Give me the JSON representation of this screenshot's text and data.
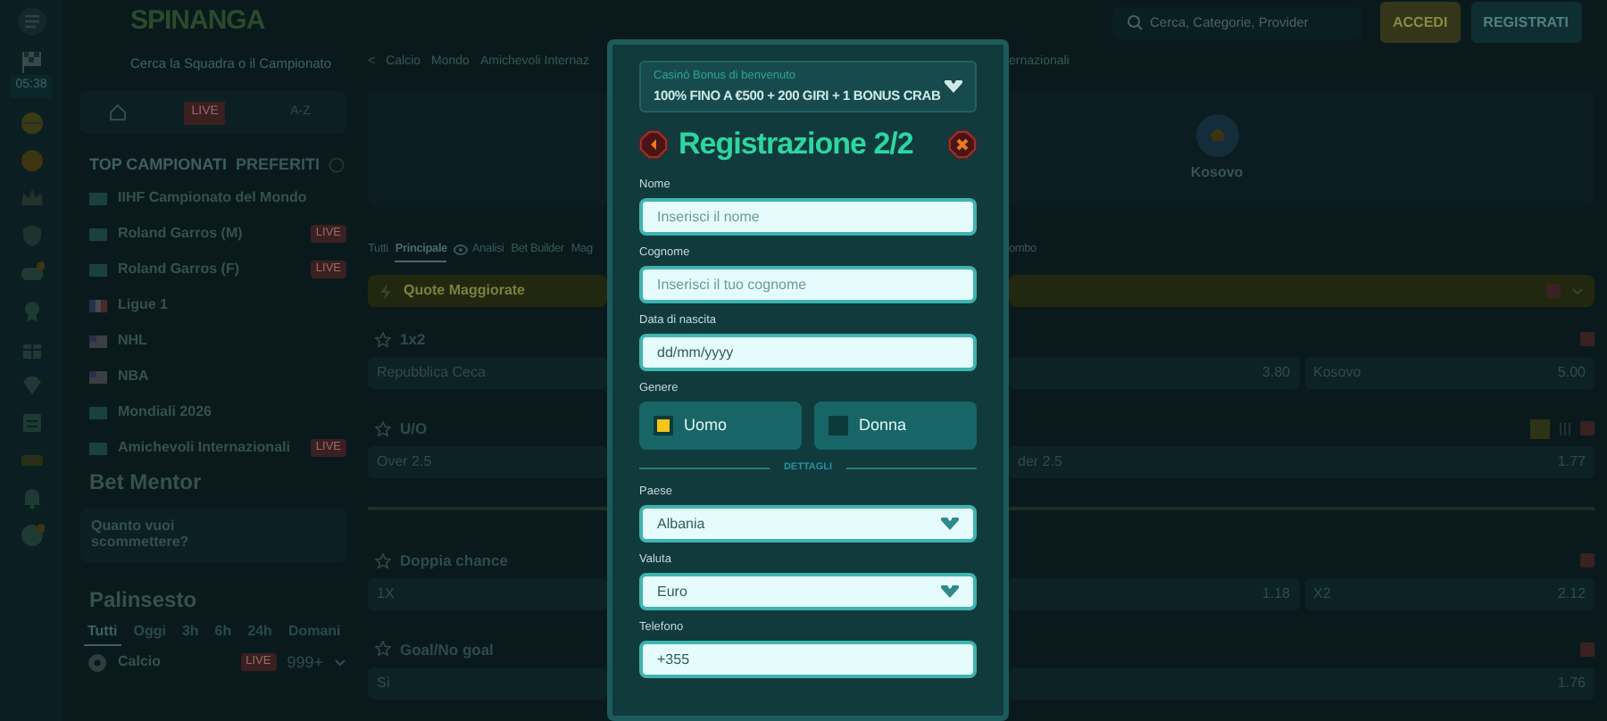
{
  "rail": {
    "clock": "05:38"
  },
  "sidebar": {
    "logo": "SPINANGA",
    "search_placeholder": "Cerca la Squadra o il Campionato",
    "tabs": [
      {
        "kind": "home"
      },
      {
        "kind": "live",
        "label": "LIVE"
      },
      {
        "kind": "text",
        "label": "A-Z"
      }
    ],
    "top_title": "TOP CAMPIONATI",
    "fav_title": "PREFERITI",
    "leagues": [
      {
        "name": "IIHF Campionato del Mondo",
        "kind": "world"
      },
      {
        "name": "Roland Garros (M)",
        "kind": "world",
        "badge": "LIVE"
      },
      {
        "name": "Roland Garros (F)",
        "kind": "world",
        "badge": "LIVE"
      },
      {
        "name": "Ligue 1",
        "kind": "france"
      },
      {
        "name": "NHL",
        "kind": "usa"
      },
      {
        "name": "NBA",
        "kind": "usa"
      },
      {
        "name": "Mondiali 2026",
        "kind": "world"
      },
      {
        "name": "Amichevoli Internazionali",
        "kind": "world",
        "badge": "LIVE"
      }
    ],
    "bet_mentor": {
      "title": "Bet Mentor",
      "prompt": "Quanto vuoi scommettere?"
    },
    "palinsesto": {
      "title": "Palinsesto",
      "filters": [
        {
          "label": "Tutti",
          "selected": true
        },
        {
          "label": "Oggi",
          "selected": false
        },
        {
          "label": "3h",
          "selected": false
        },
        {
          "label": "6h",
          "selected": false
        },
        {
          "label": "24h",
          "selected": false
        },
        {
          "label": "Domani",
          "selected": false
        }
      ],
      "sport": {
        "name": "Calcio",
        "badge": "LIVE",
        "count": "999+"
      }
    }
  },
  "header": {
    "search_placeholder": "Cerca, Categorie, Provider",
    "buttons": [
      {
        "kind": "login",
        "label": "ACCEDI"
      },
      {
        "kind": "register",
        "label": "REGISTRATI"
      }
    ]
  },
  "breadcrumb": {
    "back": "<",
    "left": [
      "Calcio",
      "Mondo",
      "Amichevoli Internaz"
    ],
    "right": "ernazionali"
  },
  "match": {
    "team": "Kosovo"
  },
  "market_tabs": {
    "left": [
      {
        "label": "Tutti",
        "selected": false
      },
      {
        "label": "Principale",
        "selected": true
      },
      {
        "label": "Analisi",
        "selected": false,
        "kind": "analysis"
      },
      {
        "label": "Bet Builder",
        "selected": false
      },
      {
        "label": "Mag",
        "selected": false
      }
    ],
    "right": "ombo"
  },
  "boost_bar": {
    "label": "Quote Maggiorate"
  },
  "markets": [
    {
      "kind": "market",
      "title": "1x2",
      "left": "Repubblica Ceca",
      "right": [
        {
          "odds": "3.80"
        },
        {
          "label": "Kosovo",
          "odds": "5.00"
        }
      ]
    },
    {
      "kind": "market",
      "title": "U/O",
      "builder": true,
      "left": "Over 2.5",
      "right": [
        {
          "label": "der 2.5",
          "odds": "1.77"
        }
      ]
    },
    {
      "kind": "divider"
    },
    {
      "kind": "market",
      "title": "Doppia chance",
      "left": "1X",
      "right": [
        {
          "odds": "1.18"
        },
        {
          "label": "X2",
          "odds": "2.12"
        }
      ]
    },
    {
      "kind": "market",
      "title": "Goal/No goal",
      "left": "Sì",
      "right": [
        {
          "odds": "1.76"
        }
      ]
    }
  ],
  "modal": {
    "bonus": {
      "title": "Casinò Bonus di benvenuto",
      "offer": "100% FINO A €500 + 200 GIRI + 1 BONUS CRAB",
      "expanded": false
    },
    "title": "Registrazione 2/2",
    "fields": [
      {
        "kind": "text",
        "label": "Nome",
        "placeholder": "Inserisci il nome"
      },
      {
        "kind": "text",
        "label": "Cognome",
        "placeholder": "Inserisci il tuo cognome"
      },
      {
        "kind": "text",
        "label": "Data di nascita",
        "value": "dd/mm/yyyy"
      },
      {
        "kind": "choice",
        "label": "Genere",
        "options": [
          {
            "label": "Uomo",
            "selected": true
          },
          {
            "label": "Donna",
            "selected": false
          }
        ]
      },
      {
        "kind": "divider",
        "label": "DETTAGLI"
      },
      {
        "kind": "select",
        "label": "Paese",
        "value": "Albania"
      },
      {
        "kind": "select",
        "label": "Valuta",
        "value": "Euro"
      },
      {
        "kind": "text",
        "label": "Telefono",
        "value": "+355"
      }
    ]
  }
}
